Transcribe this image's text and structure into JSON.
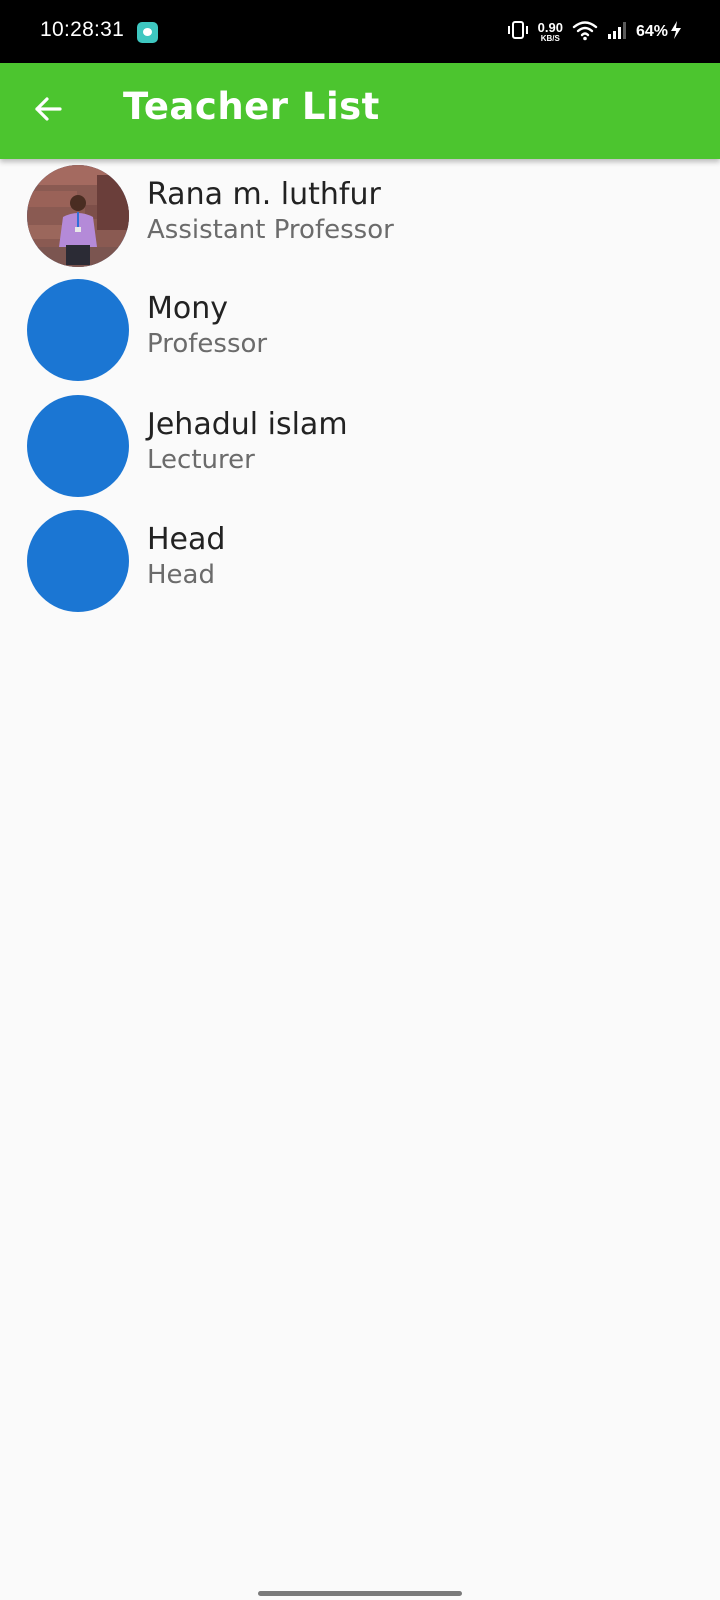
{
  "status_bar": {
    "time": "10:28:31",
    "net_speed_value": "0.90",
    "net_speed_unit": "KB/S",
    "battery": "64%",
    "icons": [
      "chat-notification-icon",
      "vibrate-icon",
      "wifi-icon",
      "signal-icon",
      "charging-icon"
    ]
  },
  "app_bar": {
    "title": "Teacher List",
    "back_icon": "arrow-back-icon",
    "background_color": "#4cc52f"
  },
  "teachers": [
    {
      "name": "Rana m. luthfur",
      "role": "Assistant Professor",
      "avatar": "photo"
    },
    {
      "name": "Mony",
      "role": "Professor",
      "avatar": "placeholder"
    },
    {
      "name": "Jehadul islam",
      "role": "Lecturer",
      "avatar": "placeholder"
    },
    {
      "name": "Head",
      "role": "Head",
      "avatar": "placeholder"
    }
  ],
  "colors": {
    "avatar_placeholder": "#1b76d3",
    "name_text": "#222222",
    "role_text": "#6b6b6b",
    "background": "#fafafa"
  }
}
